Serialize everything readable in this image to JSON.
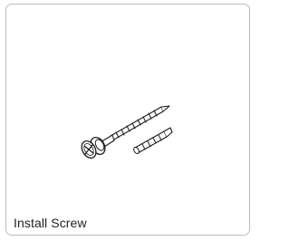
{
  "card": {
    "caption": "Install Screw",
    "illustration_icon": "screw-and-wall-anchor-icon"
  }
}
